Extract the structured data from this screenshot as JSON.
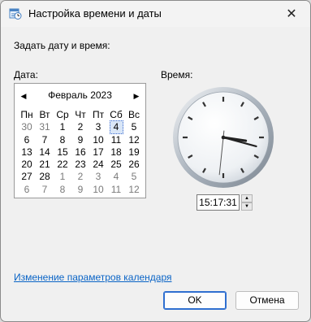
{
  "window": {
    "title": "Настройка времени и даты",
    "close_glyph": "✕"
  },
  "main": {
    "heading": "Задать дату и время:",
    "date_label": "Дата:",
    "time_label": "Время:"
  },
  "calendar": {
    "prev_glyph": "◀",
    "next_glyph": "▶",
    "month_label": "Февраль 2023",
    "weekdays": [
      "Пн",
      "Вт",
      "Ср",
      "Чт",
      "Пт",
      "Сб",
      "Вс"
    ],
    "weeks": [
      [
        {
          "d": "30",
          "o": true
        },
        {
          "d": "31",
          "o": true
        },
        {
          "d": "1"
        },
        {
          "d": "2"
        },
        {
          "d": "3"
        },
        {
          "d": "4",
          "sel": true
        },
        {
          "d": "5"
        }
      ],
      [
        {
          "d": "6"
        },
        {
          "d": "7"
        },
        {
          "d": "8"
        },
        {
          "d": "9"
        },
        {
          "d": "10"
        },
        {
          "d": "11"
        },
        {
          "d": "12"
        }
      ],
      [
        {
          "d": "13"
        },
        {
          "d": "14"
        },
        {
          "d": "15"
        },
        {
          "d": "16"
        },
        {
          "d": "17"
        },
        {
          "d": "18"
        },
        {
          "d": "19"
        }
      ],
      [
        {
          "d": "20"
        },
        {
          "d": "21"
        },
        {
          "d": "22"
        },
        {
          "d": "23"
        },
        {
          "d": "24"
        },
        {
          "d": "25"
        },
        {
          "d": "26"
        }
      ],
      [
        {
          "d": "27"
        },
        {
          "d": "28"
        },
        {
          "d": "1",
          "o": true
        },
        {
          "d": "2",
          "o": true
        },
        {
          "d": "3",
          "o": true
        },
        {
          "d": "4",
          "o": true
        },
        {
          "d": "5",
          "o": true
        }
      ],
      [
        {
          "d": "6",
          "o": true
        },
        {
          "d": "7",
          "o": true
        },
        {
          "d": "8",
          "o": true
        },
        {
          "d": "9",
          "o": true
        },
        {
          "d": "10",
          "o": true
        },
        {
          "d": "11",
          "o": true
        },
        {
          "d": "12",
          "o": true
        }
      ]
    ]
  },
  "clock": {
    "hours": 15,
    "minutes": 17,
    "seconds": 31
  },
  "time_input": {
    "value": "15:17:31",
    "up_glyph": "▲",
    "down_glyph": "▼"
  },
  "footer": {
    "link_text": "Изменение параметров календаря",
    "ok_label": "OK",
    "cancel_label": "Отмена"
  },
  "colors": {
    "link": "#0a64c6",
    "accent": "#2f6fd0",
    "clock_hand_second": "#555555"
  }
}
